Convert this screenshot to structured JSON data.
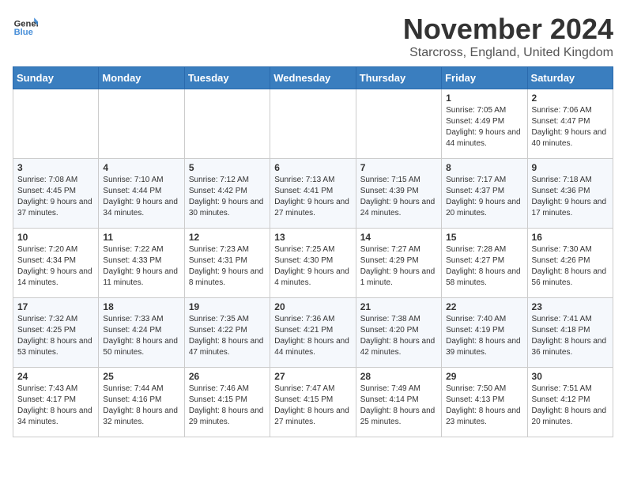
{
  "logo": {
    "general": "General",
    "blue": "Blue"
  },
  "title": "November 2024",
  "location": "Starcross, England, United Kingdom",
  "weekdays": [
    "Sunday",
    "Monday",
    "Tuesday",
    "Wednesday",
    "Thursday",
    "Friday",
    "Saturday"
  ],
  "weeks": [
    [
      {
        "day": "",
        "info": ""
      },
      {
        "day": "",
        "info": ""
      },
      {
        "day": "",
        "info": ""
      },
      {
        "day": "",
        "info": ""
      },
      {
        "day": "",
        "info": ""
      },
      {
        "day": "1",
        "info": "Sunrise: 7:05 AM\nSunset: 4:49 PM\nDaylight: 9 hours and 44 minutes."
      },
      {
        "day": "2",
        "info": "Sunrise: 7:06 AM\nSunset: 4:47 PM\nDaylight: 9 hours and 40 minutes."
      }
    ],
    [
      {
        "day": "3",
        "info": "Sunrise: 7:08 AM\nSunset: 4:45 PM\nDaylight: 9 hours and 37 minutes."
      },
      {
        "day": "4",
        "info": "Sunrise: 7:10 AM\nSunset: 4:44 PM\nDaylight: 9 hours and 34 minutes."
      },
      {
        "day": "5",
        "info": "Sunrise: 7:12 AM\nSunset: 4:42 PM\nDaylight: 9 hours and 30 minutes."
      },
      {
        "day": "6",
        "info": "Sunrise: 7:13 AM\nSunset: 4:41 PM\nDaylight: 9 hours and 27 minutes."
      },
      {
        "day": "7",
        "info": "Sunrise: 7:15 AM\nSunset: 4:39 PM\nDaylight: 9 hours and 24 minutes."
      },
      {
        "day": "8",
        "info": "Sunrise: 7:17 AM\nSunset: 4:37 PM\nDaylight: 9 hours and 20 minutes."
      },
      {
        "day": "9",
        "info": "Sunrise: 7:18 AM\nSunset: 4:36 PM\nDaylight: 9 hours and 17 minutes."
      }
    ],
    [
      {
        "day": "10",
        "info": "Sunrise: 7:20 AM\nSunset: 4:34 PM\nDaylight: 9 hours and 14 minutes."
      },
      {
        "day": "11",
        "info": "Sunrise: 7:22 AM\nSunset: 4:33 PM\nDaylight: 9 hours and 11 minutes."
      },
      {
        "day": "12",
        "info": "Sunrise: 7:23 AM\nSunset: 4:31 PM\nDaylight: 9 hours and 8 minutes."
      },
      {
        "day": "13",
        "info": "Sunrise: 7:25 AM\nSunset: 4:30 PM\nDaylight: 9 hours and 4 minutes."
      },
      {
        "day": "14",
        "info": "Sunrise: 7:27 AM\nSunset: 4:29 PM\nDaylight: 9 hours and 1 minute."
      },
      {
        "day": "15",
        "info": "Sunrise: 7:28 AM\nSunset: 4:27 PM\nDaylight: 8 hours and 58 minutes."
      },
      {
        "day": "16",
        "info": "Sunrise: 7:30 AM\nSunset: 4:26 PM\nDaylight: 8 hours and 56 minutes."
      }
    ],
    [
      {
        "day": "17",
        "info": "Sunrise: 7:32 AM\nSunset: 4:25 PM\nDaylight: 8 hours and 53 minutes."
      },
      {
        "day": "18",
        "info": "Sunrise: 7:33 AM\nSunset: 4:24 PM\nDaylight: 8 hours and 50 minutes."
      },
      {
        "day": "19",
        "info": "Sunrise: 7:35 AM\nSunset: 4:22 PM\nDaylight: 8 hours and 47 minutes."
      },
      {
        "day": "20",
        "info": "Sunrise: 7:36 AM\nSunset: 4:21 PM\nDaylight: 8 hours and 44 minutes."
      },
      {
        "day": "21",
        "info": "Sunrise: 7:38 AM\nSunset: 4:20 PM\nDaylight: 8 hours and 42 minutes."
      },
      {
        "day": "22",
        "info": "Sunrise: 7:40 AM\nSunset: 4:19 PM\nDaylight: 8 hours and 39 minutes."
      },
      {
        "day": "23",
        "info": "Sunrise: 7:41 AM\nSunset: 4:18 PM\nDaylight: 8 hours and 36 minutes."
      }
    ],
    [
      {
        "day": "24",
        "info": "Sunrise: 7:43 AM\nSunset: 4:17 PM\nDaylight: 8 hours and 34 minutes."
      },
      {
        "day": "25",
        "info": "Sunrise: 7:44 AM\nSunset: 4:16 PM\nDaylight: 8 hours and 32 minutes."
      },
      {
        "day": "26",
        "info": "Sunrise: 7:46 AM\nSunset: 4:15 PM\nDaylight: 8 hours and 29 minutes."
      },
      {
        "day": "27",
        "info": "Sunrise: 7:47 AM\nSunset: 4:15 PM\nDaylight: 8 hours and 27 minutes."
      },
      {
        "day": "28",
        "info": "Sunrise: 7:49 AM\nSunset: 4:14 PM\nDaylight: 8 hours and 25 minutes."
      },
      {
        "day": "29",
        "info": "Sunrise: 7:50 AM\nSunset: 4:13 PM\nDaylight: 8 hours and 23 minutes."
      },
      {
        "day": "30",
        "info": "Sunrise: 7:51 AM\nSunset: 4:12 PM\nDaylight: 8 hours and 20 minutes."
      }
    ]
  ]
}
